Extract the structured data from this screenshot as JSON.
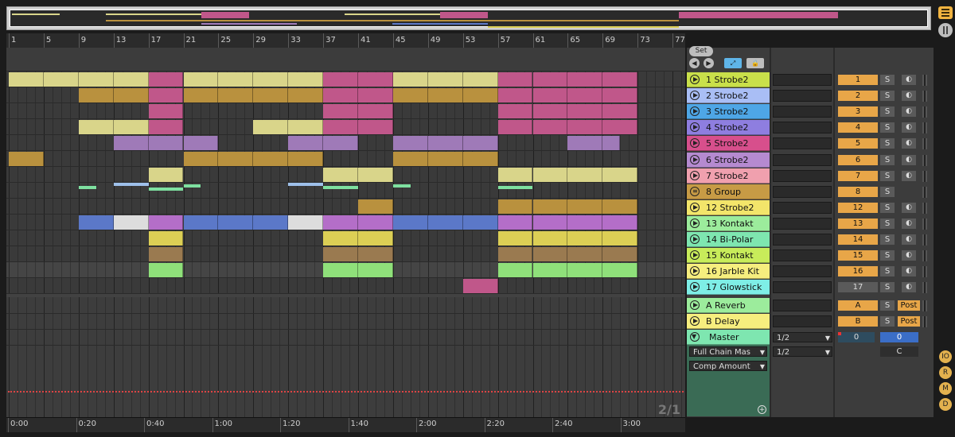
{
  "ruler": {
    "bars": [
      "1",
      "5",
      "9",
      "13",
      "17",
      "21",
      "25",
      "29",
      "33",
      "37",
      "41",
      "45",
      "49",
      "53",
      "57",
      "61",
      "65",
      "69",
      "73",
      "77"
    ]
  },
  "timebar": {
    "times": [
      "0:00",
      "0:20",
      "0:40",
      "1:00",
      "1:20",
      "1:40",
      "2:00",
      "2:20",
      "2:40",
      "3:00"
    ]
  },
  "zoom_label": "2/1",
  "set_button": "Set",
  "tracks": [
    {
      "num": "1",
      "name": "1 Strobe2",
      "color": "#c9e04a",
      "clipcolor": "#d9d58a"
    },
    {
      "num": "2",
      "name": "2 Strobe2",
      "color": "#a9bef5",
      "clipcolor": "#b9913e"
    },
    {
      "num": "3",
      "name": "3 Strobe2",
      "color": "#4ea6e6",
      "clipcolor": "#c0578a"
    },
    {
      "num": "4",
      "name": "4 Strobe2",
      "color": "#8e7ee0",
      "clipcolor": "#d9d58a"
    },
    {
      "num": "5",
      "name": "5 Strobe2",
      "color": "#d74f8c",
      "clipcolor": "#9f7ab8"
    },
    {
      "num": "6",
      "name": "6 Strobe2",
      "color": "#b58ad0",
      "clipcolor": "#b9913e"
    },
    {
      "num": "7",
      "name": "7 Strobe2",
      "color": "#f0a0ae",
      "clipcolor": "#d9d58a"
    },
    {
      "num": "8",
      "name": "8 Group",
      "color": "#c79b45",
      "clipcolor": "#7ee0a0"
    },
    {
      "num": "12",
      "name": "12 Strobe2",
      "color": "#f3e56a",
      "clipcolor": "#b9913e"
    },
    {
      "num": "13",
      "name": "13 Kontakt",
      "color": "#9cec9c",
      "clipcolor": "#5b78c8"
    },
    {
      "num": "14",
      "name": "14 Bi-Polar",
      "color": "#7ee6b0",
      "clipcolor": "#dccf55"
    },
    {
      "num": "15",
      "name": "15 Kontakt",
      "color": "#c8ec5a",
      "clipcolor": "#9a7a50"
    },
    {
      "num": "16",
      "name": "16 Jarble Kit",
      "color": "#f6ee7e",
      "clipcolor": "#8fe07a"
    },
    {
      "num": "17",
      "name": "17 Glowstick",
      "color": "#7eeee6",
      "clipcolor": "#c0578a"
    }
  ],
  "returns": [
    {
      "letter": "A",
      "name": "A Reverb",
      "color": "#9cec9c",
      "post": "Post"
    },
    {
      "letter": "B",
      "name": "B Delay",
      "color": "#f6ee7e",
      "post": "Post"
    }
  ],
  "master": {
    "name": "Master",
    "color": "#7ee6b0",
    "device_chooser": "Full Chain Mas",
    "param_chooser": "Comp Amount",
    "cue_out": "1/2",
    "master_out": "1/2",
    "volume": "0",
    "pan": "0",
    "crossfade": "C"
  },
  "solo_label": "S",
  "tool_labels": [
    "IO",
    "R",
    "M",
    "D"
  ],
  "colors": {
    "accent": "#e8a648",
    "master_panel": "#3a6b55"
  }
}
